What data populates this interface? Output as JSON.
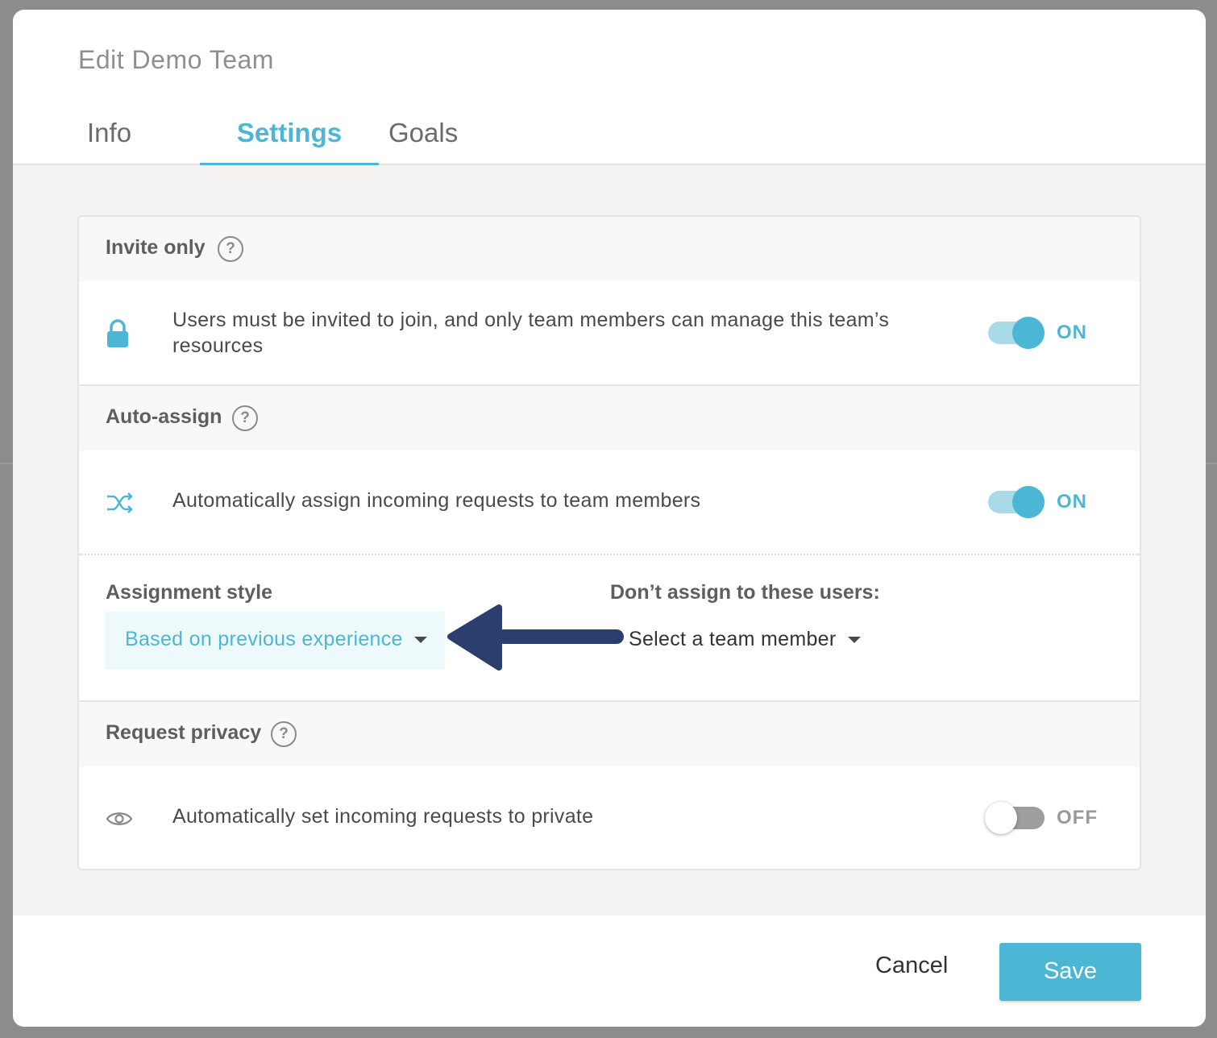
{
  "modal": {
    "title": "Edit Demo Team",
    "tabs": [
      {
        "label": "Info",
        "active": false
      },
      {
        "label": "Settings",
        "active": true
      },
      {
        "label": "Goals",
        "active": false
      }
    ]
  },
  "sections": {
    "invite_only": {
      "title": "Invite only",
      "help": "?",
      "icon": "lock-icon",
      "description": "Users must be invited to join, and only team members can manage this team’s resources",
      "toggle_state": "ON"
    },
    "auto_assign": {
      "title": "Auto-assign",
      "help": "?",
      "icon": "shuffle-icon",
      "description": "Automatically assign incoming requests to team members",
      "toggle_state": "ON",
      "assignment_style_label": "Assignment style",
      "assignment_style_value": "Based on previous experience",
      "exclude_label": "Don’t assign to these users:",
      "exclude_placeholder": "Select a team member"
    },
    "request_privacy": {
      "title": "Request privacy",
      "help": "?",
      "icon": "eye-icon",
      "description": "Automatically set incoming requests to private",
      "toggle_state": "OFF"
    }
  },
  "footer": {
    "cancel_label": "Cancel",
    "save_label": "Save"
  },
  "colors": {
    "accent": "#4cb7d4",
    "arrow": "#2b3e6e"
  }
}
